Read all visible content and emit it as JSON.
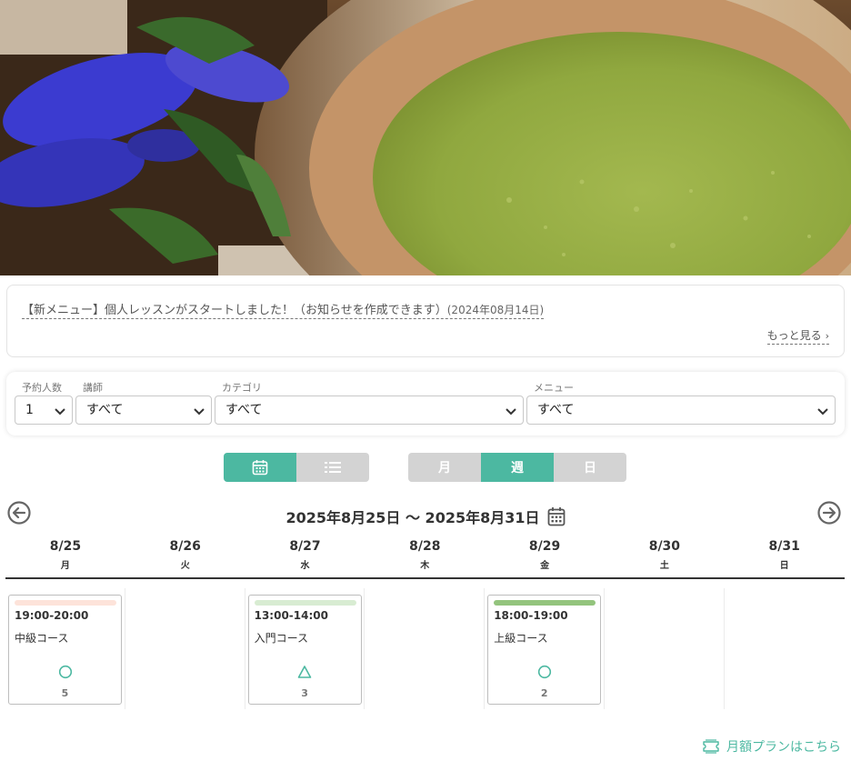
{
  "notice": {
    "text": "【新メニュー】個人レッスンがスタートしました！（お知らせを作成できます）",
    "date": "(2024年08月14日)",
    "more": "もっと見る"
  },
  "filters": {
    "people": {
      "label": "予約人数",
      "value": "1"
    },
    "teacher": {
      "label": "講師",
      "value": "すべて"
    },
    "category": {
      "label": "カテゴリ",
      "value": "すべて"
    },
    "menu": {
      "label": "メニュー",
      "value": "すべて"
    }
  },
  "view_toggle": {
    "calendar_icon": "calendar-icon",
    "list_icon": "list-icon",
    "active": "calendar"
  },
  "period_toggle": {
    "month": "月",
    "week": "週",
    "day": "日",
    "active": "week"
  },
  "range": {
    "text": "2025年8月25日 〜 2025年8月31日"
  },
  "days": [
    {
      "date": "8/25",
      "weekday": "月"
    },
    {
      "date": "8/26",
      "weekday": "火"
    },
    {
      "date": "8/27",
      "weekday": "水"
    },
    {
      "date": "8/28",
      "weekday": "木"
    },
    {
      "date": "8/29",
      "weekday": "金"
    },
    {
      "date": "8/30",
      "weekday": "土"
    },
    {
      "date": "8/31",
      "weekday": "日"
    }
  ],
  "lessons": [
    {
      "time": "19:00-20:00",
      "course": "中級コース",
      "availability": "circle",
      "count": "5",
      "color": "#fde3da"
    },
    {
      "time": "13:00-14:00",
      "course": "入門コース",
      "availability": "triangle",
      "count": "3",
      "color": "#d8ecd2"
    },
    {
      "time": "18:00-19:00",
      "course": "上級コース",
      "availability": "circle",
      "count": "2",
      "color": "#93c47d"
    }
  ],
  "monthly_plan": {
    "label": "月額プランはこちら"
  },
  "colors": {
    "accent": "#4cb8a1",
    "inactive": "#d3d3d3"
  }
}
